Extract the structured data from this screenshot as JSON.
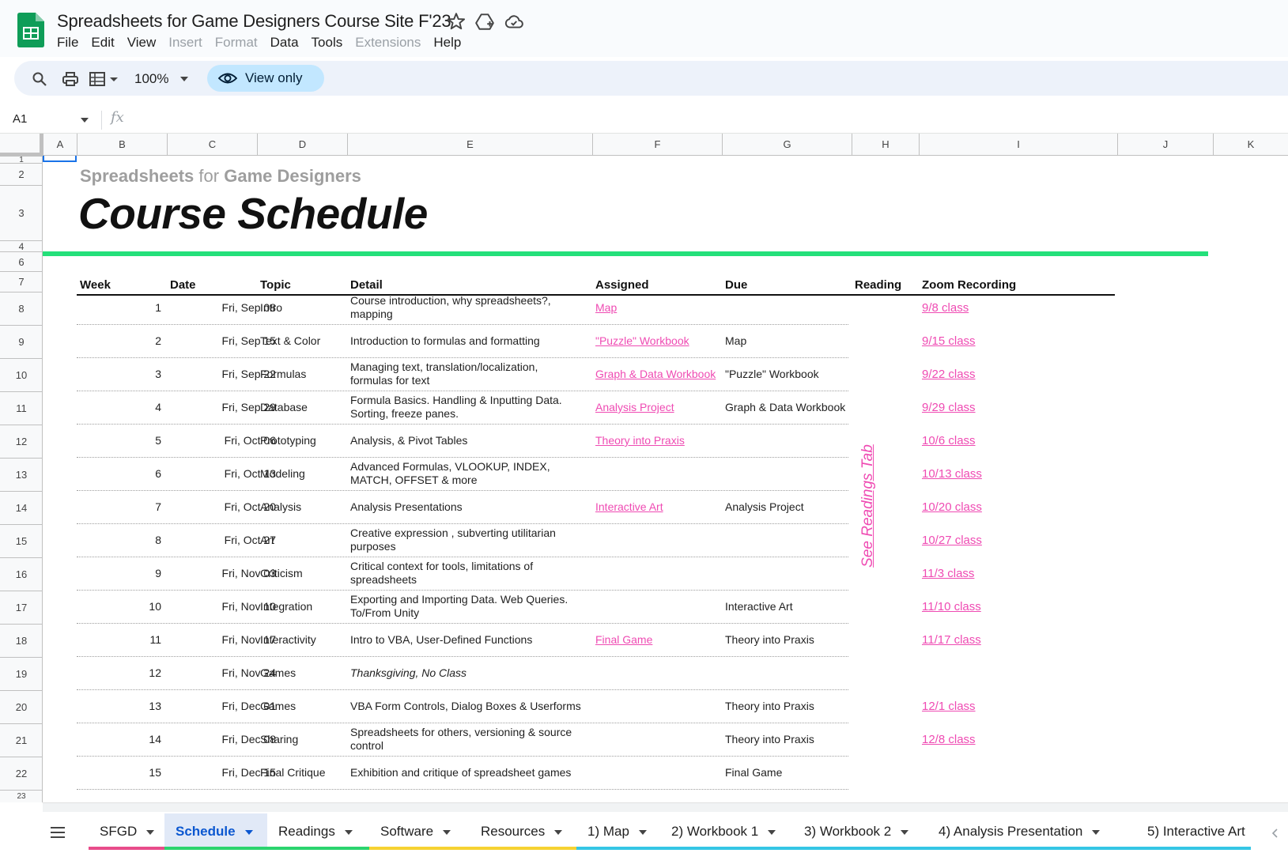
{
  "app": {
    "title": "Spreadsheets for Game Designers Course Site F'23",
    "menu": [
      "File",
      "Edit",
      "View",
      "Insert",
      "Format",
      "Data",
      "Tools",
      "Extensions",
      "Help"
    ],
    "disabled_menu": [
      "Insert",
      "Format",
      "Extensions"
    ],
    "zoom": "100%",
    "view_only": "View only",
    "name_box": "A1",
    "fx": "fx"
  },
  "grid": {
    "columns": [
      "A",
      "B",
      "C",
      "D",
      "E",
      "F",
      "G",
      "H",
      "I",
      "J",
      "K"
    ],
    "rows": [
      "1",
      "2",
      "3",
      "4",
      "6",
      "7",
      "8",
      "9",
      "10",
      "11",
      "12",
      "13",
      "14",
      "15",
      "16",
      "17",
      "18",
      "19",
      "20",
      "21",
      "22",
      "23"
    ]
  },
  "sheet": {
    "subtitle_a": "Spreadsheets",
    "subtitle_b": "for",
    "subtitle_c": "Game Designers",
    "title": "Course Schedule",
    "headers": [
      "Week",
      "Date",
      "Topic",
      "Detail",
      "Assigned",
      "Due",
      "Reading",
      "Zoom Recording"
    ],
    "reading_note": "See Readings Tab",
    "rows": [
      {
        "week": "1",
        "date": "Fri, Sep 08",
        "topic": "Intro",
        "detail": [
          "Course introduction, why spreadsheets?,",
          "mapping"
        ],
        "assigned": "Map",
        "due": "",
        "zoom": "9/8 class"
      },
      {
        "week": "2",
        "date": "Fri, Sep 15",
        "topic": "Text & Color",
        "detail": [
          "Introduction to formulas and formatting"
        ],
        "assigned": "\"Puzzle\" Workbook",
        "due": "Map",
        "zoom": "9/15 class"
      },
      {
        "week": "3",
        "date": "Fri, Sep 22",
        "topic": "Formulas",
        "detail": [
          "Managing text, translation/localization,",
          "formulas for text"
        ],
        "assigned": "Graph & Data Workbook",
        "due": "\"Puzzle\" Workbook",
        "zoom": "9/22 class"
      },
      {
        "week": "4",
        "date": "Fri, Sep 29",
        "topic": "Database",
        "detail": [
          "Formula Basics. Handling & Inputting Data.",
          "Sorting, freeze panes."
        ],
        "assigned": "Analysis Project",
        "due": "Graph & Data Workbook",
        "zoom": "9/29 class"
      },
      {
        "week": "5",
        "date": "Fri, Oct 06",
        "topic": "Prototyping",
        "detail": [
          "Analysis, & Pivot Tables"
        ],
        "assigned": "Theory into Praxis",
        "due": "",
        "zoom": "10/6 class"
      },
      {
        "week": "6",
        "date": "Fri, Oct 13",
        "topic": "Modeling",
        "detail": [
          "Advanced Formulas, VLOOKUP, INDEX,",
          "MATCH, OFFSET & more"
        ],
        "assigned": "",
        "due": "",
        "zoom": "10/13 class"
      },
      {
        "week": "7",
        "date": "Fri, Oct 20",
        "topic": "Analysis",
        "detail": [
          "Analysis Presentations"
        ],
        "assigned": "Interactive Art",
        "due": "Analysis Project",
        "zoom": "10/20 class"
      },
      {
        "week": "8",
        "date": "Fri, Oct 27",
        "topic": "Art",
        "detail": [
          "Creative expression , subverting utilitarian",
          "purposes"
        ],
        "assigned": "",
        "due": "",
        "zoom": "10/27 class"
      },
      {
        "week": "9",
        "date": "Fri, Nov 03",
        "topic": "Criticism",
        "detail": [
          "Critical context for tools, limitations of",
          "spreadsheets"
        ],
        "assigned": "",
        "due": "",
        "zoom": "11/3 class"
      },
      {
        "week": "10",
        "date": "Fri, Nov 10",
        "topic": "Integration",
        "detail": [
          "Exporting and Importing Data. Web Queries.",
          "To/From Unity"
        ],
        "assigned": "",
        "due": "Interactive Art",
        "zoom": "11/10 class"
      },
      {
        "week": "11",
        "date": "Fri, Nov 17",
        "topic": "Interactivity",
        "detail": [
          "Intro to VBA, User-Defined Functions"
        ],
        "assigned": "Final Game",
        "due": "Theory into Praxis",
        "zoom": "11/17 class"
      },
      {
        "week": "12",
        "date": "Fri, Nov 24",
        "topic": "Games",
        "detail": [
          "Thanksgiving, No Class"
        ],
        "italic": true,
        "assigned": "",
        "due": "",
        "zoom": ""
      },
      {
        "week": "13",
        "date": "Fri, Dec 01",
        "topic": "Games",
        "detail": [
          "VBA Form Controls, Dialog Boxes & Userforms"
        ],
        "assigned": "",
        "due": "Theory into Praxis",
        "zoom": "12/1 class"
      },
      {
        "week": "14",
        "date": "Fri, Dec 08",
        "topic": "Sharing",
        "detail": [
          "Spreadsheets for others, versioning & source",
          "control"
        ],
        "assigned": "",
        "due": "Theory into Praxis",
        "zoom": "12/8 class"
      },
      {
        "week": "15",
        "date": "Fri, Dec 15",
        "topic": "Final Critique",
        "detail": [
          "Exhibition and critique of spreadsheet games"
        ],
        "assigned": "",
        "due": "Final Game",
        "zoom": ""
      }
    ]
  },
  "tabs": [
    {
      "label": "SFGD",
      "color": "#e84c8a"
    },
    {
      "label": "Schedule",
      "color": "#2bd46e",
      "active": true
    },
    {
      "label": "Readings",
      "color": "#2bd46e"
    },
    {
      "label": "Software",
      "color": "#f6d232"
    },
    {
      "label": "Resources",
      "color": "#f6d232"
    },
    {
      "label": "1) Map",
      "color": "#35c6e5"
    },
    {
      "label": "2) Workbook 1",
      "color": "#35c6e5"
    },
    {
      "label": "3) Workbook 2",
      "color": "#35c6e5"
    },
    {
      "label": "4) Analysis Presentation",
      "color": "#35c6e5"
    },
    {
      "label": "5) Interactive Art",
      "color": "#35c6e5"
    }
  ],
  "colors": {
    "accent_green": "#24e07a",
    "link_pink": "#ef4bb3",
    "view_only_bg": "#c2e7ff"
  }
}
